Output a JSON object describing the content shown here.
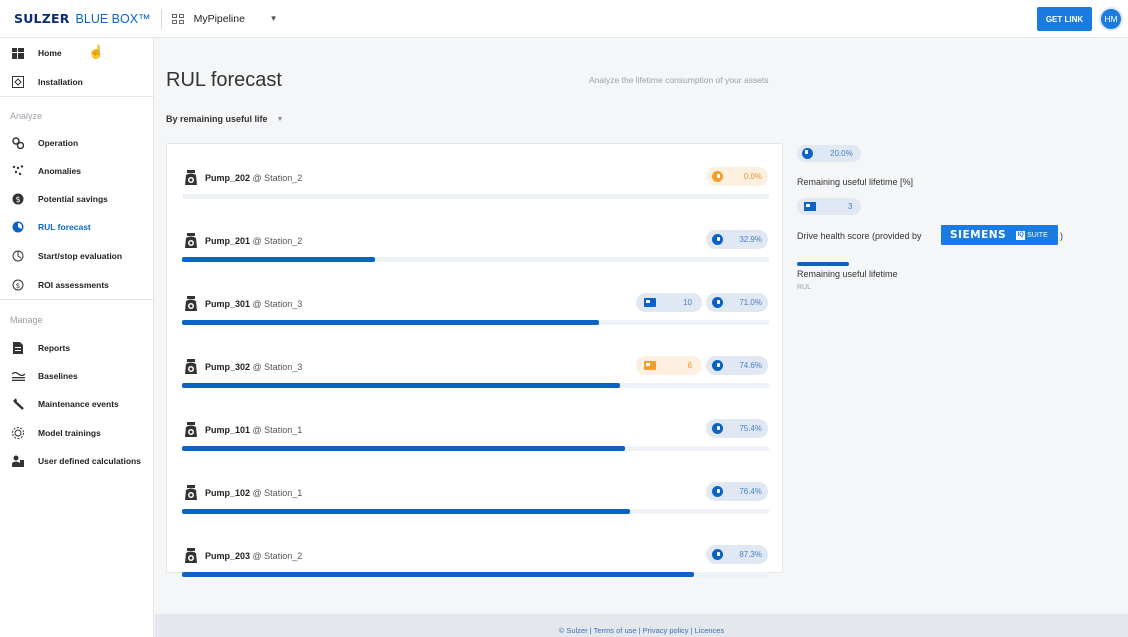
{
  "topbar": {
    "brand_sulzer": "SULZER",
    "brand_product": "BLUE BOX™",
    "pipeline_name": "MyPipeline",
    "pipeline_icon": "grid-icon",
    "get_link_label": "GET LINK",
    "avatar_initials": "HM",
    "accent_color": "#1a7be0"
  },
  "sidebar": {
    "items_top": [
      {
        "label": "Home",
        "icon": "home-icon"
      },
      {
        "label": "Installation",
        "icon": "installation-icon"
      }
    ],
    "section_analyze": "Analyze",
    "items_analyze": [
      {
        "label": "Operation",
        "icon": "operation-icon"
      },
      {
        "label": "Anomalies",
        "icon": "anomalies-icon"
      },
      {
        "label": "Potential savings",
        "icon": "savings-icon"
      },
      {
        "label": "RUL forecast",
        "icon": "rul-icon",
        "active": true
      },
      {
        "label": "Start/stop evaluation",
        "icon": "startstop-icon"
      },
      {
        "label": "ROI assessments",
        "icon": "roi-icon"
      }
    ],
    "section_manage": "Manage",
    "items_manage": [
      {
        "label": "Reports",
        "icon": "reports-icon"
      },
      {
        "label": "Baselines",
        "icon": "baselines-icon"
      },
      {
        "label": "Maintenance events",
        "icon": "wrench-icon"
      },
      {
        "label": "Model trainings",
        "icon": "model-icon"
      },
      {
        "label": "User defined calculations",
        "icon": "user-calc-icon"
      }
    ]
  },
  "main": {
    "title": "RUL forecast",
    "subtitle": "Analyze the lifetime consumption of your assets",
    "sort_label": "By remaining useful life",
    "assets": [
      {
        "name": "Pump_202",
        "at": "@ Station_2",
        "rul": "0.0%",
        "rul_fraction": 0.0,
        "rul_warn": true,
        "drive_health": null,
        "bar_fraction": 0.0
      },
      {
        "name": "Pump_201",
        "at": "@ Station_2",
        "rul": "32.9%",
        "rul_warn": false,
        "drive_health": null,
        "bar_fraction": 0.329
      },
      {
        "name": "Pump_301",
        "at": "@ Station_3",
        "rul": "71.0%",
        "rul_warn": false,
        "drive_health": "10",
        "dh_warn": false,
        "bar_fraction": 0.71
      },
      {
        "name": "Pump_302",
        "at": "@ Station_3",
        "rul": "74.6%",
        "rul_warn": false,
        "drive_health": "6",
        "dh_warn": true,
        "bar_fraction": 0.746
      },
      {
        "name": "Pump_101",
        "at": "@ Station_1",
        "rul": "75.4%",
        "rul_warn": false,
        "drive_health": null,
        "bar_fraction": 0.754
      },
      {
        "name": "Pump_102",
        "at": "@ Station_1",
        "rul": "76.4%",
        "rul_warn": false,
        "drive_health": null,
        "bar_fraction": 0.764
      },
      {
        "name": "Pump_203",
        "at": "@ Station_2",
        "rul": "87.3%",
        "rul_warn": false,
        "drive_health": null,
        "bar_fraction": 0.873
      }
    ]
  },
  "legend": {
    "rul_example": "20.0%",
    "rul_text": "Remaining useful lifetime [%]",
    "dh_example": "3",
    "dh_text_prefix": "Drive health score (provided by",
    "dh_text_suffix": ")",
    "siemens": "SIEMENS",
    "iq": "IQ",
    "suite": "SUITE",
    "bar_text": "Remaining useful lifetime",
    "bar_sub": "RUL"
  },
  "footer": {
    "text": "© Sulzer | Terms of use | Privacy policy | Licences"
  }
}
